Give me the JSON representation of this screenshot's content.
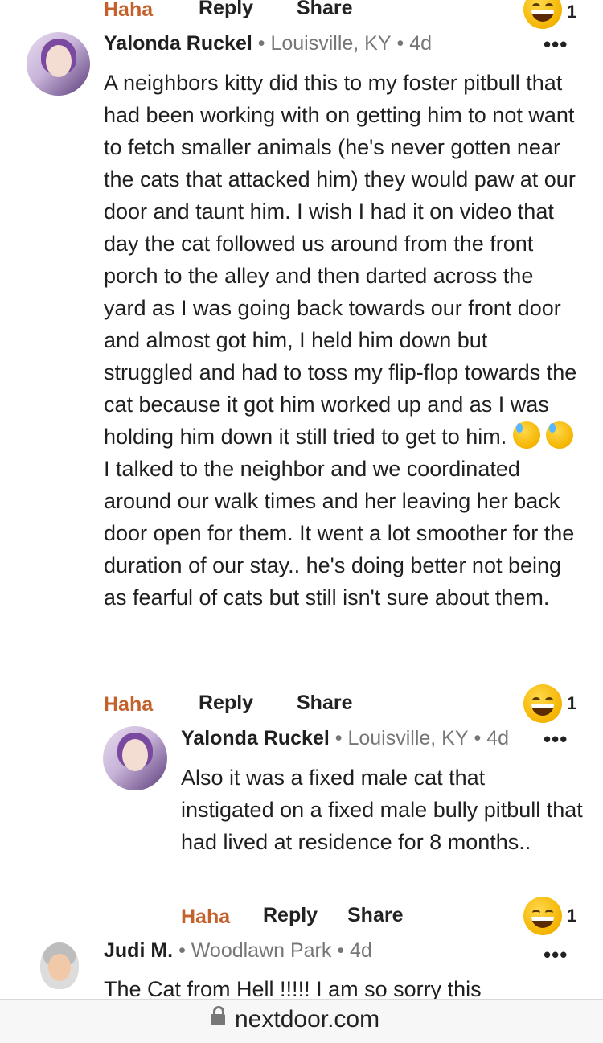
{
  "actions": {
    "haha": "Haha",
    "reply": "Reply",
    "share": "Share"
  },
  "top_reactions": {
    "count": "1"
  },
  "comment1": {
    "author": "Yalonda Ruckel",
    "location": "Louisville, KY",
    "age": "4d",
    "text_before": "A neighbors kitty did this to my foster pitbull that had been working with on getting him to not want to fetch smaller animals (he's never gotten near the cats that attacked him) they would paw at our door and taunt him. I wish I had it on video that day the cat followed us around from the front porch to the alley and then darted across the yard as I was going back towards our front door and almost got him, I held him down but struggled and had to toss my flip-flop towards the cat because it got him worked up and as I was holding him down it still tried to get to him. ",
    "text_after": " I talked to the neighbor and we coordinated around our walk times and her leaving her back door open for them. It went a lot smoother for the duration of our stay.. he's doing better not being as fearful of cats but still isn't sure about them.",
    "reaction_count": "1"
  },
  "reply1": {
    "author": "Yalonda Ruckel",
    "location": "Louisville, KY",
    "age": "4d",
    "text": "Also it was a fixed male cat that instigated on a fixed male bully pitbull that had lived at residence for 8 months..",
    "reaction_count": "1"
  },
  "comment2": {
    "author": "Judi M.",
    "location": "Woodlawn Park",
    "age": "4d",
    "text": "The Cat from Hell !!!!! I am so sorry this"
  },
  "footer": {
    "domain": "nextdoor.com"
  },
  "colors": {
    "haha": "#c4602a",
    "meta": "#767676"
  }
}
